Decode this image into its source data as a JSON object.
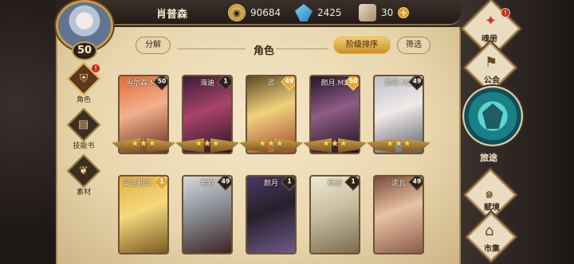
{
  "player": {
    "name": "肖普森",
    "level": "50"
  },
  "resources": {
    "gold": "90684",
    "gems": "2425",
    "books": "30"
  },
  "page": {
    "title": "角色"
  },
  "buttons": {
    "decompose": "分解",
    "sort": "阶级排序",
    "filter": "筛选"
  },
  "sidenav": [
    {
      "label": "角色",
      "icon": "helmet-icon",
      "alert": "!"
    },
    {
      "label": "技能书",
      "icon": "skill-book-icon",
      "alert": ""
    },
    {
      "label": "素材",
      "icon": "material-icon",
      "alert": ""
    }
  ],
  "cards": [
    {
      "name": "雪尔森.MZ",
      "level": "50",
      "gold": true
    },
    {
      "name": "海迪",
      "level": "1",
      "gold": false
    },
    {
      "name": "源",
      "level": "49",
      "gold": true
    },
    {
      "name": "颜月.MZ",
      "level": "50",
      "gold": true
    },
    {
      "name": "索菲.MZ",
      "level": "49",
      "gold": false
    },
    {
      "name": "安洁莉亚.MZ",
      "level": "1",
      "gold": true
    },
    {
      "name": "希欧",
      "level": "49",
      "gold": false
    },
    {
      "name": "颜月",
      "level": "1",
      "gold": false
    },
    {
      "name": "杨波",
      "level": "1",
      "gold": false
    },
    {
      "name": "诺瓦",
      "level": "49",
      "gold": false
    }
  ],
  "right_menu": {
    "summon": "魂册",
    "guild": "公会",
    "journey": "旅途",
    "talent": "赋境",
    "market": "市集"
  }
}
